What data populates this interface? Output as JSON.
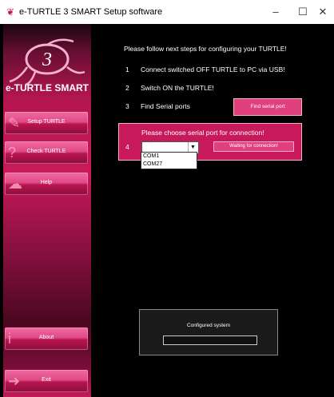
{
  "window": {
    "title": "e-TURTLE 3 SMART Setup software",
    "minimize": "–",
    "maximize": "☐",
    "close": "✕"
  },
  "sidebar": {
    "brand": "e-TURTLE SMART",
    "logo_number": "3",
    "items": [
      {
        "label": "Setup TURTLE",
        "icon": "wrench-icon"
      },
      {
        "label": "Check TURTLE",
        "icon": "question-icon"
      },
      {
        "label": "Help",
        "icon": "turtle-icon"
      },
      {
        "label": "About",
        "icon": "info-icon"
      },
      {
        "label": "Exit",
        "icon": "exit-icon"
      }
    ]
  },
  "main": {
    "heading": "Please follow next steps for configuring your TURTLE!",
    "steps": [
      {
        "num": "1",
        "text": "Connect switched OFF TURTLE to PC via USB!"
      },
      {
        "num": "2",
        "text": "Switch ON the TURTLE!"
      },
      {
        "num": "3",
        "text": "Find Serial ports"
      }
    ],
    "find_button": "Find serial port",
    "choose": {
      "num": "4",
      "title": "Please choose serial port for connection!",
      "selected": "",
      "options": [
        "COM1",
        "COM27"
      ],
      "status": "Waiting for connection!"
    },
    "configured": {
      "label": "Configured system",
      "value": ""
    }
  },
  "colors": {
    "accent": "#e0417c",
    "panel": "#c81a5a",
    "background": "#000000"
  }
}
